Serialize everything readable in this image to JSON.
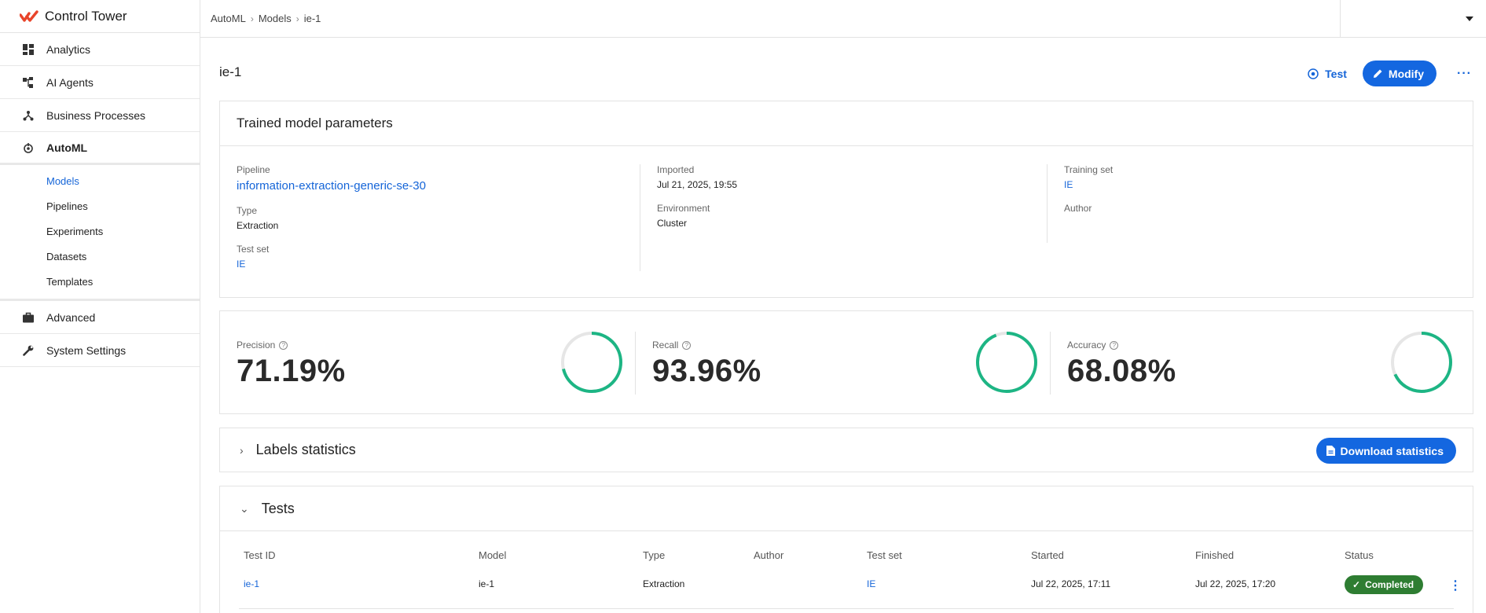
{
  "app": {
    "brand_name": "Control Tower",
    "brand_color": "#e8442a",
    "accent_color": "#1467e0"
  },
  "sidebar": {
    "items": [
      {
        "label": "Analytics",
        "icon": "dashboard-icon"
      },
      {
        "label": "AI Agents",
        "icon": "agents-icon"
      },
      {
        "label": "Business Processes",
        "icon": "process-icon"
      },
      {
        "label": "AutoML",
        "icon": "automl-icon"
      },
      {
        "label": "Advanced",
        "icon": "briefcase-icon"
      },
      {
        "label": "System Settings",
        "icon": "wrench-icon"
      }
    ],
    "subitems": [
      "Models",
      "Pipelines",
      "Experiments",
      "Datasets",
      "Templates"
    ],
    "active_subitem": "Models"
  },
  "breadcrumb": [
    "AutoML",
    "Models",
    "ie-1"
  ],
  "page": {
    "title": "ie-1",
    "test_label": "Test",
    "modify_label": "Modify",
    "more_label": "···"
  },
  "params": {
    "title": "Trained model parameters",
    "pipeline_label": "Pipeline",
    "pipeline_value": "information-extraction-generic-se-30",
    "type_label": "Type",
    "type_value": "Extraction",
    "testset_label": "Test set",
    "testset_value": "IE",
    "imported_label": "Imported",
    "imported_value": "Jul 21, 2025, 19:55",
    "environment_label": "Environment",
    "environment_value": "Cluster",
    "trainingset_label": "Training set",
    "trainingset_value": "IE",
    "author_label": "Author"
  },
  "metrics": [
    {
      "label": "Precision",
      "value": "71.19%",
      "fraction": 0.7119
    },
    {
      "label": "Recall",
      "value": "93.96%",
      "fraction": 0.9396
    },
    {
      "label": "Accuracy",
      "value": "68.08%",
      "fraction": 0.6808
    }
  ],
  "ring_color": "#1db584",
  "ring_track_color": "#e6e6e6",
  "labels_stats": {
    "title": "Labels statistics",
    "download_label": "Download statistics"
  },
  "tests": {
    "title": "Tests",
    "columns": [
      "Test ID",
      "Model",
      "Type",
      "Author",
      "Test set",
      "Started",
      "Finished",
      "Status"
    ],
    "rows": [
      {
        "test_id": "ie-1",
        "model": "ie-1",
        "type": "Extraction",
        "author": "",
        "test_set": "IE",
        "started": "Jul 22, 2025, 17:11",
        "finished": "Jul 22, 2025, 17:20",
        "status": "Completed"
      }
    ]
  }
}
